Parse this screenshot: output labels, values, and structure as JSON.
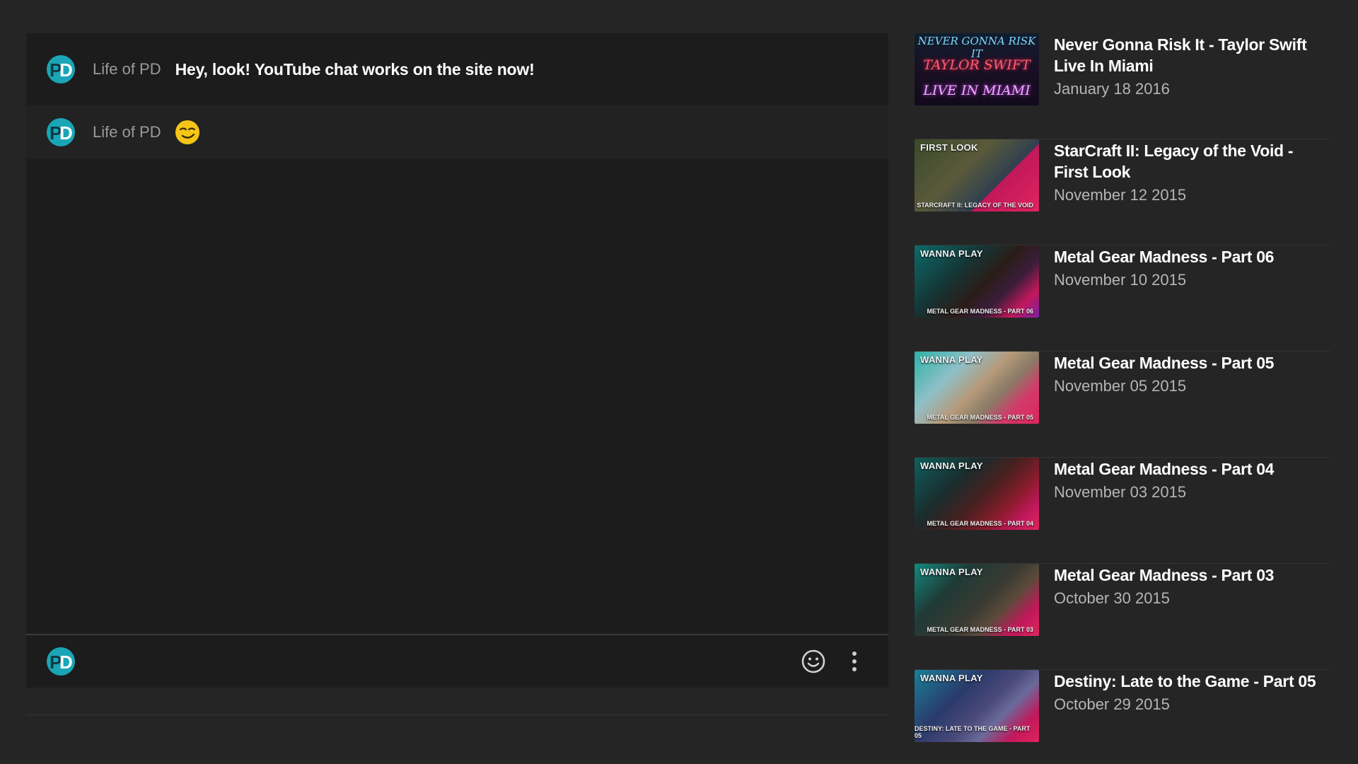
{
  "chat": {
    "messages": [
      {
        "author": "Life of PD",
        "text": "Hey, look! YouTube chat works on the site now!"
      },
      {
        "author": "Life of PD",
        "emoji": "smirking-face"
      }
    ],
    "input": {
      "avatar": "PD",
      "emoji_button": "smiley-icon",
      "more_button": "more-vertical-icon"
    },
    "avatar_text": "PD"
  },
  "videos": [
    {
      "title": "Never Gonna Risk It - Taylor Swift Live In Miami",
      "date": "January 18 2016",
      "thumb": {
        "line1": "NEVER GONNA RISK IT",
        "line2": "TAYLOR SWIFT",
        "line3": "LIVE IN MIAMI"
      }
    },
    {
      "title": "StarCraft II: Legacy of the Void - First Look",
      "date": "November 12 2015",
      "thumb": {
        "tag": "FIRST LOOK",
        "sub": "STARCRAFT II: LEGACY OF THE VOID"
      }
    },
    {
      "title": "Metal Gear Madness - Part 06",
      "date": "November 10 2015",
      "thumb": {
        "tag": "WANNA PLAY",
        "sub": "METAL GEAR MADNESS - PART 06"
      }
    },
    {
      "title": "Metal Gear Madness - Part 05",
      "date": "November 05 2015",
      "thumb": {
        "tag": "WANNA PLAY",
        "sub": "METAL GEAR MADNESS - PART 05"
      }
    },
    {
      "title": "Metal Gear Madness - Part 04",
      "date": "November 03 2015",
      "thumb": {
        "tag": "WANNA PLAY",
        "sub": "METAL GEAR MADNESS - PART 04"
      }
    },
    {
      "title": "Metal Gear Madness - Part 03",
      "date": "October 30 2015",
      "thumb": {
        "tag": "WANNA PLAY",
        "sub": "METAL GEAR MADNESS - PART 03"
      }
    },
    {
      "title": "Destiny: Late to the Game - Part 05",
      "date": "October 29 2015",
      "thumb": {
        "tag": "WANNA PLAY",
        "sub": "DESTINY: LATE TO THE GAME - PART 05"
      }
    }
  ],
  "colors": {
    "background": "#252525",
    "panel": "#1c1c1c",
    "avatar_teal": "#1aa6b7",
    "brand_pink": "#e0245e",
    "emoji_yellow": "#f5c518"
  }
}
